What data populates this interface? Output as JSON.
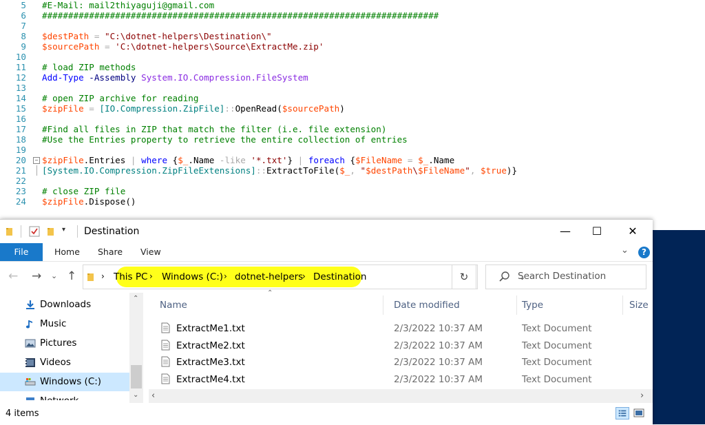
{
  "editor": {
    "lines": [
      {
        "num": "5",
        "tokens": [
          {
            "t": "#E-Mail: mail2thiyaguji@gmail.com",
            "c": "t-comment"
          }
        ]
      },
      {
        "num": "6",
        "tokens": [
          {
            "t": "############################################################################",
            "c": "t-comment"
          }
        ]
      },
      {
        "num": "7",
        "tokens": []
      },
      {
        "num": "8",
        "tokens": [
          {
            "t": "$destPath",
            "c": "t-var"
          },
          {
            "t": " = ",
            "c": "t-op"
          },
          {
            "t": "\"C:\\dotnet-helpers\\Destination\\\"",
            "c": "t-str"
          }
        ]
      },
      {
        "num": "9",
        "tokens": [
          {
            "t": "$sourcePath",
            "c": "t-var"
          },
          {
            "t": " = ",
            "c": "t-op"
          },
          {
            "t": "'C:\\dotnet-helpers\\Source\\ExtractMe.zip'",
            "c": "t-str"
          }
        ]
      },
      {
        "num": "10",
        "tokens": []
      },
      {
        "num": "11",
        "tokens": [
          {
            "t": "# load ZIP methods",
            "c": "t-comment"
          }
        ]
      },
      {
        "num": "12",
        "tokens": [
          {
            "t": "Add-Type",
            "c": "t-cmd"
          },
          {
            "t": " ",
            "c": "t-mem"
          },
          {
            "t": "-Assembly",
            "c": "t-param"
          },
          {
            "t": " ",
            "c": "t-mem"
          },
          {
            "t": "System.IO.Compression.FileSystem",
            "c": "t-arg"
          }
        ]
      },
      {
        "num": "13",
        "tokens": []
      },
      {
        "num": "14",
        "tokens": [
          {
            "t": "# open ZIP archive for reading",
            "c": "t-comment"
          }
        ]
      },
      {
        "num": "15",
        "tokens": [
          {
            "t": "$zipFile",
            "c": "t-var"
          },
          {
            "t": " = ",
            "c": "t-op"
          },
          {
            "t": "[IO.Compression.ZipFile]",
            "c": "t-type"
          },
          {
            "t": "::",
            "c": "t-op"
          },
          {
            "t": "OpenRead(",
            "c": "t-mem"
          },
          {
            "t": "$sourcePath",
            "c": "t-var"
          },
          {
            "t": ")",
            "c": "t-mem"
          }
        ]
      },
      {
        "num": "16",
        "tokens": []
      },
      {
        "num": "17",
        "tokens": [
          {
            "t": "#Find all files in ZIP that match the filter (i.e. file extension)",
            "c": "t-comment"
          }
        ]
      },
      {
        "num": "18",
        "tokens": [
          {
            "t": "#Use the Entries property to retrieve the entire collection of entries",
            "c": "t-comment"
          }
        ]
      },
      {
        "num": "19",
        "tokens": []
      },
      {
        "num": "20",
        "fold": "box",
        "tokens": [
          {
            "t": "$zipFile",
            "c": "t-var"
          },
          {
            "t": ".Entries ",
            "c": "t-mem"
          },
          {
            "t": "|",
            "c": "t-op"
          },
          {
            "t": " ",
            "c": "t-mem"
          },
          {
            "t": "where",
            "c": "t-cmd"
          },
          {
            "t": " {",
            "c": "t-mem"
          },
          {
            "t": "$_",
            "c": "t-var"
          },
          {
            "t": ".Name ",
            "c": "t-mem"
          },
          {
            "t": "-like",
            "c": "t-op"
          },
          {
            "t": " ",
            "c": "t-mem"
          },
          {
            "t": "'*.txt'",
            "c": "t-str"
          },
          {
            "t": "} ",
            "c": "t-mem"
          },
          {
            "t": "|",
            "c": "t-op"
          },
          {
            "t": " ",
            "c": "t-mem"
          },
          {
            "t": "foreach",
            "c": "t-cmd"
          },
          {
            "t": " {",
            "c": "t-mem"
          },
          {
            "t": "$FileName",
            "c": "t-var"
          },
          {
            "t": " = ",
            "c": "t-op"
          },
          {
            "t": "$_",
            "c": "t-var"
          },
          {
            "t": ".Name",
            "c": "t-mem"
          }
        ]
      },
      {
        "num": "21",
        "fold": "line",
        "tokens": [
          {
            "t": "[System.IO.Compression.ZipFileExtensions]",
            "c": "t-type"
          },
          {
            "t": "::",
            "c": "t-op"
          },
          {
            "t": "ExtractToFile(",
            "c": "t-mem"
          },
          {
            "t": "$_",
            "c": "t-var"
          },
          {
            "t": ", ",
            "c": "t-op"
          },
          {
            "t": "\"",
            "c": "t-str"
          },
          {
            "t": "$destPath",
            "c": "t-var"
          },
          {
            "t": "\\",
            "c": "t-str"
          },
          {
            "t": "$FileName",
            "c": "t-var"
          },
          {
            "t": "\"",
            "c": "t-str"
          },
          {
            "t": ", ",
            "c": "t-op"
          },
          {
            "t": "$true",
            "c": "t-var"
          },
          {
            "t": ")}",
            "c": "t-mem"
          }
        ]
      },
      {
        "num": "22",
        "tokens": []
      },
      {
        "num": "23",
        "tokens": [
          {
            "t": "# close ZIP file",
            "c": "t-comment"
          }
        ]
      },
      {
        "num": "24",
        "tokens": [
          {
            "t": "$zipFile",
            "c": "t-var"
          },
          {
            "t": ".Dispose()",
            "c": "t-mem"
          }
        ]
      }
    ]
  },
  "explorer": {
    "window_title": "Destination",
    "window_controls": {
      "minimize": "—",
      "maximize": "☐",
      "close": "✕"
    },
    "ribbon": {
      "file": "File",
      "home": "Home",
      "share": "Share",
      "view": "View",
      "help": "?"
    },
    "address": {
      "crumbs": [
        "This PC",
        "Windows (C:)",
        "dotnet-helpers",
        "Destination"
      ],
      "highlight_color": "#ffff1a"
    },
    "search": {
      "placeholder": "Search Destination"
    },
    "nav_items": [
      {
        "label": "Downloads",
        "icon": "download-icon",
        "selected": false
      },
      {
        "label": "Music",
        "icon": "music-icon",
        "selected": false
      },
      {
        "label": "Pictures",
        "icon": "pictures-icon",
        "selected": false
      },
      {
        "label": "Videos",
        "icon": "videos-icon",
        "selected": false
      },
      {
        "label": "Windows (C:)",
        "icon": "drive-icon",
        "selected": true
      },
      {
        "label": "Network",
        "icon": "network-icon",
        "selected": false
      }
    ],
    "columns": {
      "name": "Name",
      "date": "Date modified",
      "type": "Type",
      "size": "Size"
    },
    "files": [
      {
        "name": "ExtractMe1.txt",
        "date": "2/3/2022 10:37 AM",
        "type": "Text Document"
      },
      {
        "name": "ExtractMe2.txt",
        "date": "2/3/2022 10:37 AM",
        "type": "Text Document"
      },
      {
        "name": "ExtractMe3.txt",
        "date": "2/3/2022 10:37 AM",
        "type": "Text Document"
      },
      {
        "name": "ExtractMe4.txt",
        "date": "2/3/2022 10:37 AM",
        "type": "Text Document"
      }
    ],
    "status": {
      "item_count": "4 items"
    },
    "accent_color": "#1979ca"
  }
}
